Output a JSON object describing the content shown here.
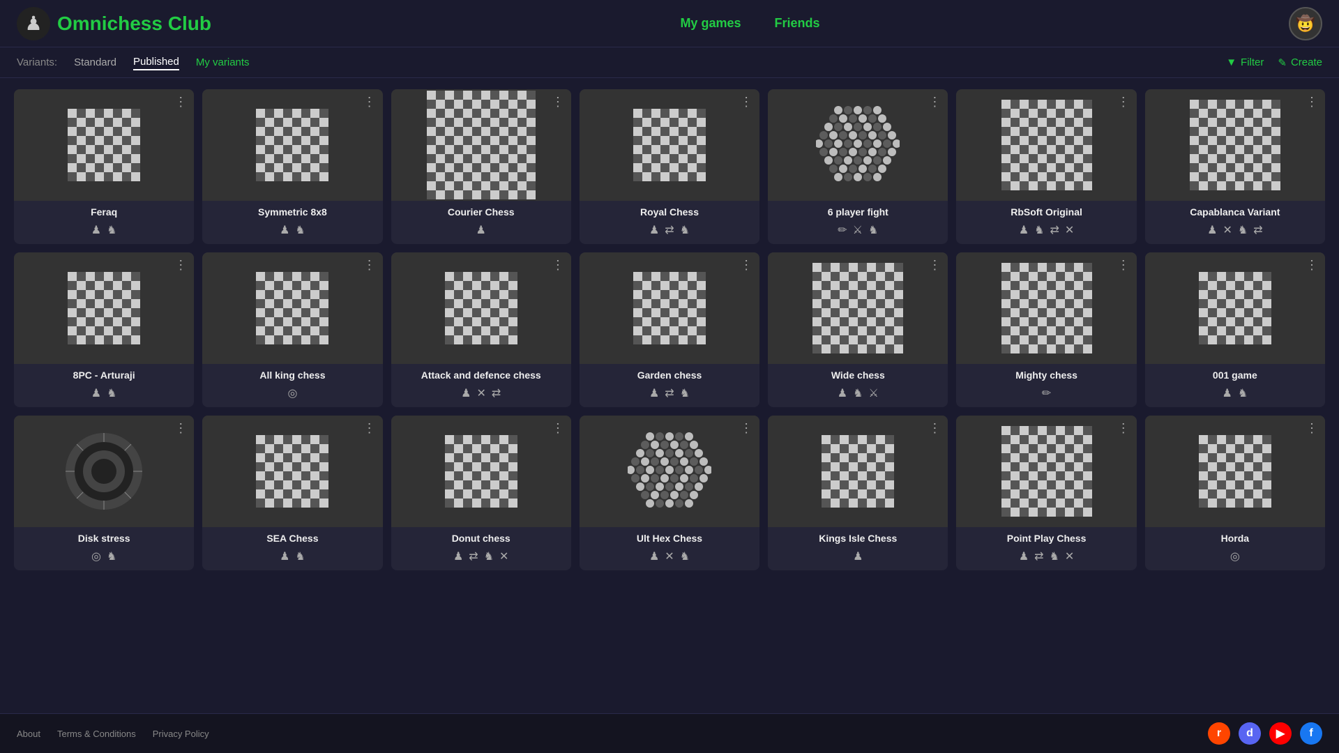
{
  "header": {
    "logo_text": "Omnichess Club",
    "nav": [
      {
        "label": "My games",
        "href": "#"
      },
      {
        "label": "Friends",
        "href": "#"
      }
    ],
    "user_icon": "🤠"
  },
  "variants_bar": {
    "label": "Variants:",
    "tabs": [
      {
        "label": "Standard",
        "active": false
      },
      {
        "label": "Published",
        "active": true
      },
      {
        "label": "My variants",
        "active": false,
        "green": true
      }
    ],
    "filter_label": "Filter",
    "create_label": "Create"
  },
  "cards": [
    {
      "id": "feraq",
      "title": "Feraq",
      "icons": [
        "♟",
        "♞"
      ],
      "board": "8",
      "color": "color1"
    },
    {
      "id": "symmetric8x8",
      "title": "Symmetric 8x8",
      "icons": [
        "♟",
        "♞"
      ],
      "board": "8",
      "color": "color2"
    },
    {
      "id": "courier-chess",
      "title": "Courier Chess",
      "icons": [
        "♟"
      ],
      "board": "12",
      "color": "color3"
    },
    {
      "id": "royal-chess",
      "title": "Royal Chess",
      "icons": [
        "♟",
        "⇄",
        "♞"
      ],
      "board": "8",
      "color": "color4"
    },
    {
      "id": "6player-fight",
      "title": "6 player fight",
      "icons": [
        "✏",
        "⚔",
        "♞"
      ],
      "board": "hex",
      "color": "color5"
    },
    {
      "id": "rbsoft-original",
      "title": "RbSoft Original",
      "icons": [
        "♟",
        "♞",
        "⇄",
        "✕"
      ],
      "board": "10",
      "color": "color6"
    },
    {
      "id": "capablanca-variant",
      "title": "Capablanca Variant",
      "icons": [
        "♟",
        "✕",
        "♞",
        "⇄"
      ],
      "board": "10",
      "color": "color7"
    },
    {
      "id": "8pc-arturaji",
      "title": "8PC - Arturaji",
      "icons": [
        "♟",
        "♞"
      ],
      "board": "8",
      "color": "color1"
    },
    {
      "id": "all-king-chess",
      "title": "All king chess",
      "icons": [
        "◎"
      ],
      "board": "8",
      "color": "color2"
    },
    {
      "id": "attack-defence",
      "title": "Attack and defence chess",
      "icons": [
        "♟",
        "✕",
        "⇄"
      ],
      "board": "8",
      "color": "color3"
    },
    {
      "id": "garden-chess",
      "title": "Garden chess",
      "icons": [
        "♟",
        "⇄",
        "♞"
      ],
      "board": "8",
      "color": "color4"
    },
    {
      "id": "wide-chess",
      "title": "Wide chess",
      "icons": [
        "♟",
        "♞",
        "⚔"
      ],
      "board": "10",
      "color": "color5"
    },
    {
      "id": "mighty-chess",
      "title": "Mighty chess",
      "icons": [
        "✏"
      ],
      "board": "10",
      "color": "color6"
    },
    {
      "id": "001-game",
      "title": "001 game",
      "icons": [
        "♟",
        "♞"
      ],
      "board": "8",
      "color": "color7"
    },
    {
      "id": "disk-stress",
      "title": "Disk stress",
      "icons": [
        "◎",
        "♞"
      ],
      "board": "round",
      "color": "color1"
    },
    {
      "id": "sea-chess",
      "title": "SEA Chess",
      "icons": [
        "♟",
        "♞"
      ],
      "board": "8",
      "color": "color2"
    },
    {
      "id": "donut-chess",
      "title": "Donut chess",
      "icons": [
        "♟",
        "⇄",
        "♞",
        "✕"
      ],
      "board": "8",
      "color": "color3"
    },
    {
      "id": "ult-hex-chess",
      "title": "Ult Hex Chess",
      "icons": [
        "♟",
        "✕",
        "♞"
      ],
      "board": "hex2",
      "color": "color4"
    },
    {
      "id": "kings-isle-chess",
      "title": "Kings Isle Chess",
      "icons": [
        "♟"
      ],
      "board": "8",
      "color": "color5"
    },
    {
      "id": "point-play-chess",
      "title": "Point Play Chess",
      "icons": [
        "♟",
        "⇄",
        "♞",
        "✕"
      ],
      "board": "10",
      "color": "color6"
    },
    {
      "id": "horda",
      "title": "Horda",
      "icons": [
        "◎"
      ],
      "board": "8",
      "color": "color7"
    }
  ],
  "footer": {
    "links": [
      "About",
      "Terms & Conditions",
      "Privacy Policy"
    ],
    "social": [
      "reddit",
      "discord",
      "youtube",
      "facebook"
    ]
  }
}
